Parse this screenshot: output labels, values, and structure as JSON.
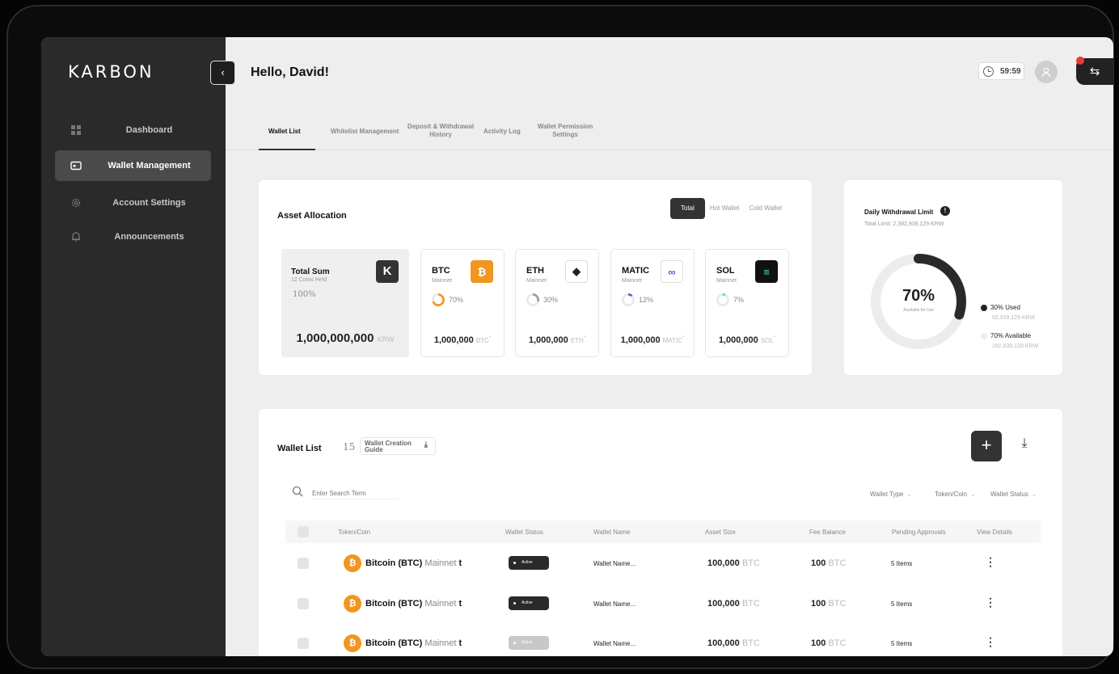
{
  "app": {
    "logo": "KARBON",
    "greeting": "Hello, David!",
    "timer": "59:59"
  },
  "sidebar": {
    "items": [
      {
        "label": "Dashboard",
        "icon": "grid-icon",
        "active": false
      },
      {
        "label": "Wallet Management",
        "icon": "wallet-icon",
        "active": true
      },
      {
        "label": "Account Settings",
        "icon": "gear-icon",
        "active": false
      },
      {
        "label": "Announcements",
        "icon": "bell-icon",
        "active": false
      }
    ]
  },
  "tabs": [
    {
      "label": "Wallet List",
      "active": true
    },
    {
      "label": "Whitelist Management"
    },
    {
      "label": "Deposit & Withdrawal History"
    },
    {
      "label": "Activity Log"
    },
    {
      "label": "Wallet Permission Settings"
    }
  ],
  "asset": {
    "title": "Asset Allocation",
    "segments": [
      "Total",
      "Hot Wallet",
      "Cold Wallet"
    ],
    "total": {
      "title": "Total Sum",
      "sub": "12 Coins Held",
      "pct": "100%",
      "amount": "1,000,000,000",
      "unit": "KRW",
      "logo": "K"
    },
    "coins": [
      {
        "sym": "BTC",
        "net": "Mainnet",
        "pct": "70%",
        "pct_value": 70,
        "amount": "1,000,000",
        "unit": "BTC",
        "color": "#f0961f",
        "logo": "₿",
        "logo_color": "#ffffff",
        "ring_color": "#f0961f"
      },
      {
        "sym": "ETH",
        "net": "Mainnet",
        "pct": "30%",
        "pct_value": 30,
        "amount": "1,000,000",
        "unit": "ETH",
        "color": "#ffffff",
        "logo": "◆",
        "logo_color": "#222222",
        "ring_color": "#999999"
      },
      {
        "sym": "MATIC",
        "net": "Mainnet",
        "pct": "12%",
        "pct_value": 12,
        "amount": "1,000,000",
        "unit": "MATIC",
        "color": "#ffffff",
        "logo": "∞",
        "logo_color": "#7b4ce0",
        "ring_color": "#7b4ce0"
      },
      {
        "sym": "SOL",
        "net": "Mainnet",
        "pct": "7%",
        "pct_value": 7,
        "amount": "1,000,000",
        "unit": "SOL",
        "color": "#111111",
        "logo": "≡",
        "logo_color": "#3fe0a8",
        "ring_color": "#3fe0a8"
      }
    ]
  },
  "limit": {
    "title": "Daily Withdrawal Limit",
    "total": "Total Limit: 2,392,939,129 KRW",
    "pct": "70%",
    "pct_label": "Available for Use",
    "used_fraction": 0.3,
    "used_label": "30% Used",
    "used_amount": "92,939,129 KRW",
    "avail_label": "70% Available",
    "avail_amount": "192,839,129 KRW"
  },
  "wallet_list": {
    "title": "Wallet List",
    "count": "15",
    "guide": "Wallet Creation Guide",
    "search_placeholder": "Enter Search Term",
    "filters": [
      "Wallet Type",
      "Token/Coin",
      "Wallet Status"
    ],
    "columns": [
      "Token/Coin",
      "Wallet Status",
      "Wallet Name",
      "Asset Size",
      "Fee Balance",
      "Pending Approvals",
      "View Details"
    ],
    "rows": [
      {
        "coin": "Bitcoin (BTC)",
        "net": "Mainnet",
        "suffix": "t",
        "status": "Active",
        "name": "Wallet Name...",
        "asset": "100,000",
        "asset_unit": "BTC",
        "fee": "100",
        "fee_unit": "BTC",
        "pending": "5 Items",
        "dim": false
      },
      {
        "coin": "Bitcoin (BTC)",
        "net": "Mainnet",
        "suffix": "t",
        "status": "Active",
        "name": "Wallet Name...",
        "asset": "100,000",
        "asset_unit": "BTC",
        "fee": "100",
        "fee_unit": "BTC",
        "pending": "5 Items",
        "dim": false
      },
      {
        "coin": "Bitcoin (BTC)",
        "net": "Mainnet",
        "suffix": "t",
        "status": "Active",
        "name": "Wallet Name...",
        "asset": "100,000",
        "asset_unit": "BTC",
        "fee": "100",
        "fee_unit": "BTC",
        "pending": "5 Items",
        "dim": true
      }
    ]
  }
}
